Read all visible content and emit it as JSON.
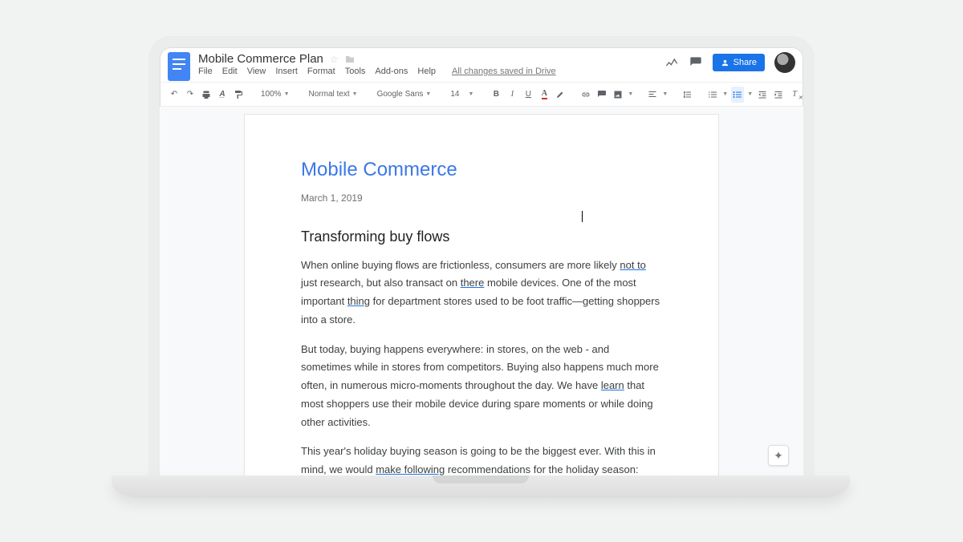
{
  "header": {
    "doc_title": "Mobile Commerce Plan",
    "saved_text": "All changes saved in Drive",
    "share_label": "Share"
  },
  "menus": [
    "File",
    "Edit",
    "View",
    "Insert",
    "Format",
    "Tools",
    "Add-ons",
    "Help"
  ],
  "toolbar": {
    "zoom": "100%",
    "style": "Normal text",
    "font": "Google Sans",
    "size": "14"
  },
  "document": {
    "title": "Mobile Commerce",
    "date": "March 1, 2019",
    "heading": "Transforming buy flows",
    "p1a": "When online buying flows are frictionless, consumers are more likely ",
    "p1_err1": "not to",
    "p1b": " just research, but also transact on ",
    "p1_err2": "there",
    "p1c": " mobile devices. One of the most important ",
    "p1_err3": "thing",
    "p1d": " for department stores used to be foot traffic—getting shoppers into a store.",
    "p2a": "But today, buying happens everywhere: in stores, on the web - and sometimes while in stores from competitors. Buying also happens much more often, in numerous micro-moments throughout the day. We have ",
    "p2_err1": "learn",
    "p2b": " that most shoppers use their mobile device during spare moments or while doing other activities.",
    "p3a": "This year's holiday buying season is going to be the biggest ever. With this in mind, we would ",
    "p3_err1": "make following",
    "p3b": " recommendations for the holiday season:"
  }
}
